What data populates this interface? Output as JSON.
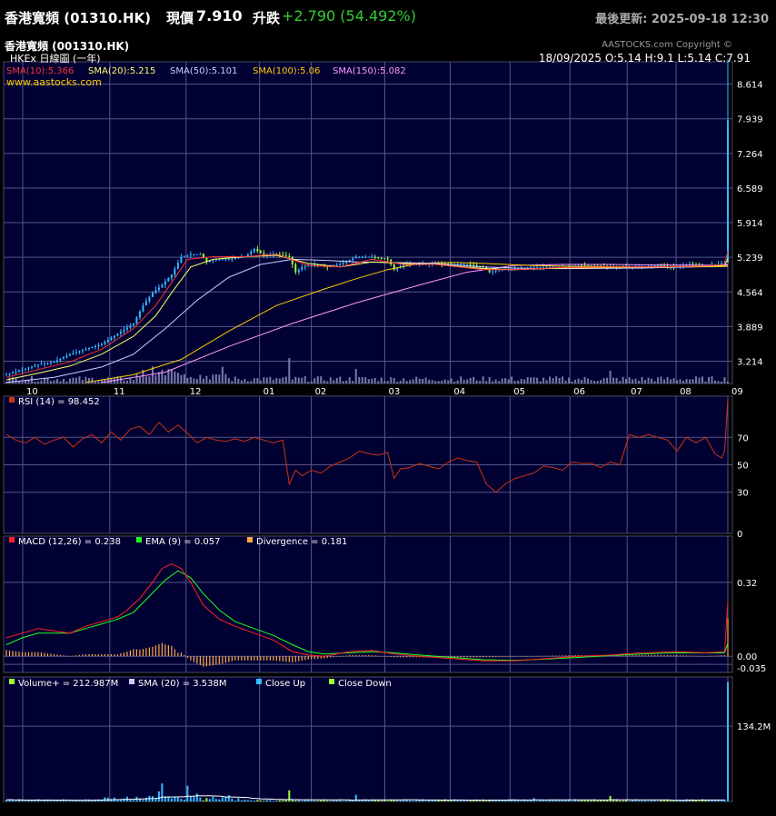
{
  "header": {
    "title": "香港寬頻 (01310.HK)",
    "price_label": "現價",
    "price": "7.910",
    "change_label": "升跌",
    "change": "+2.790 (54.492%)",
    "last_update": "最後更新: 2025-09-18 12:30"
  },
  "chart_info": {
    "name": "香港寬頻 (001310.HK)",
    "subtitle": "HKEx 日線圖 (一年)",
    "copyright": "AASTOCKS.com Copyright ©",
    "website": "www.aastocks.com",
    "ohlc": "18/09/2025   O:5.14  H:9.1  L:5.14  C:7.91"
  },
  "colors": {
    "bg": "#000033",
    "grid": "#55558a",
    "sma10": "#ff3333",
    "sma20": "#ffff66",
    "sma50": "#ccccff",
    "sma100": "#ffcc00",
    "sma150": "#ff99ff",
    "close_up": "#33bbff",
    "close_down": "#99ff33",
    "rsi": "#cc3311",
    "macd": "#ff2222",
    "ema": "#22ff22",
    "divergence": "#ffaa44"
  },
  "chart_data": [
    {
      "type": "line",
      "panel": "price",
      "legend": [
        {
          "key": "sma10",
          "label": "SMA(10):5.366"
        },
        {
          "key": "sma20",
          "label": "SMA(20):5.215"
        },
        {
          "key": "sma50",
          "label": "SMA(50):5.101"
        },
        {
          "key": "sma100",
          "label": "SMA(100):5.06"
        },
        {
          "key": "sma150",
          "label": "SMA(150):5.082"
        }
      ],
      "x_ticks": [
        "10",
        "11",
        "12",
        "01",
        "02",
        "03",
        "04",
        "05",
        "06",
        "07",
        "08",
        "09"
      ],
      "y_ticks": [
        3.214,
        3.889,
        4.564,
        5.239,
        5.914,
        6.589,
        7.264,
        7.939,
        8.614
      ],
      "ylim": [
        2.78,
        9.05
      ],
      "close_series": [
        [
          0,
          2.95
        ],
        [
          5,
          3.05
        ],
        [
          10,
          3.15
        ],
        [
          15,
          3.2
        ],
        [
          20,
          3.35
        ],
        [
          25,
          3.45
        ],
        [
          30,
          3.55
        ],
        [
          35,
          3.75
        ],
        [
          40,
          3.95
        ],
        [
          43,
          4.3
        ],
        [
          46,
          4.55
        ],
        [
          49,
          4.7
        ],
        [
          52,
          4.9
        ],
        [
          55,
          5.25
        ],
        [
          58,
          5.3
        ],
        [
          61,
          5.3
        ],
        [
          63,
          5.15
        ],
        [
          66,
          5.2
        ],
        [
          70,
          5.2
        ],
        [
          75,
          5.25
        ],
        [
          78,
          5.4
        ],
        [
          81,
          5.28
        ],
        [
          85,
          5.3
        ],
        [
          89,
          5.25
        ],
        [
          91,
          4.95
        ],
        [
          93,
          5.05
        ],
        [
          97,
          5.1
        ],
        [
          101,
          5.05
        ],
        [
          105,
          5.1
        ],
        [
          110,
          5.25
        ],
        [
          115,
          5.25
        ],
        [
          120,
          5.2
        ],
        [
          122,
          5.0
        ],
        [
          125,
          5.1
        ],
        [
          130,
          5.1
        ],
        [
          135,
          5.12
        ],
        [
          140,
          5.1
        ],
        [
          145,
          5.1
        ],
        [
          150,
          5.05
        ],
        [
          152,
          4.95
        ],
        [
          155,
          5.0
        ],
        [
          160,
          5.02
        ],
        [
          165,
          5.05
        ],
        [
          170,
          5.05
        ],
        [
          175,
          5.05
        ],
        [
          180,
          5.08
        ],
        [
          185,
          5.07
        ],
        [
          190,
          5.06
        ],
        [
          195,
          5.05
        ],
        [
          200,
          5.06
        ],
        [
          205,
          5.08
        ],
        [
          210,
          5.06
        ],
        [
          215,
          5.1
        ],
        [
          220,
          5.08
        ],
        [
          224,
          5.1
        ],
        [
          226,
          5.14
        ],
        [
          227,
          7.91
        ]
      ],
      "sma_series": {
        "sma10": [
          [
            0,
            2.9
          ],
          [
            10,
            3.05
          ],
          [
            20,
            3.2
          ],
          [
            30,
            3.45
          ],
          [
            40,
            3.85
          ],
          [
            47,
            4.3
          ],
          [
            52,
            4.75
          ],
          [
            57,
            5.2
          ],
          [
            65,
            5.25
          ],
          [
            75,
            5.25
          ],
          [
            85,
            5.3
          ],
          [
            95,
            5.08
          ],
          [
            105,
            5.05
          ],
          [
            115,
            5.2
          ],
          [
            125,
            5.1
          ],
          [
            135,
            5.1
          ],
          [
            150,
            5.0
          ],
          [
            160,
            5.0
          ],
          [
            175,
            5.04
          ],
          [
            190,
            5.05
          ],
          [
            205,
            5.05
          ],
          [
            220,
            5.07
          ],
          [
            226,
            5.1
          ],
          [
            227,
            5.366
          ]
        ],
        "sma20": [
          [
            0,
            2.85
          ],
          [
            10,
            2.98
          ],
          [
            20,
            3.12
          ],
          [
            30,
            3.35
          ],
          [
            40,
            3.7
          ],
          [
            47,
            4.1
          ],
          [
            52,
            4.55
          ],
          [
            58,
            5.05
          ],
          [
            65,
            5.2
          ],
          [
            75,
            5.25
          ],
          [
            85,
            5.28
          ],
          [
            95,
            5.12
          ],
          [
            105,
            5.05
          ],
          [
            115,
            5.15
          ],
          [
            125,
            5.12
          ],
          [
            135,
            5.1
          ],
          [
            150,
            5.02
          ],
          [
            160,
            5.0
          ],
          [
            175,
            5.03
          ],
          [
            190,
            5.04
          ],
          [
            205,
            5.05
          ],
          [
            220,
            5.06
          ],
          [
            226,
            5.08
          ],
          [
            227,
            5.215
          ]
        ],
        "sma50": [
          [
            0,
            2.8
          ],
          [
            15,
            2.9
          ],
          [
            30,
            3.1
          ],
          [
            40,
            3.35
          ],
          [
            50,
            3.85
          ],
          [
            60,
            4.4
          ],
          [
            70,
            4.85
          ],
          [
            80,
            5.1
          ],
          [
            90,
            5.2
          ],
          [
            100,
            5.18
          ],
          [
            110,
            5.15
          ],
          [
            120,
            5.14
          ],
          [
            135,
            5.12
          ],
          [
            150,
            5.05
          ],
          [
            165,
            5.02
          ],
          [
            180,
            5.02
          ],
          [
            200,
            5.03
          ],
          [
            215,
            5.05
          ],
          [
            227,
            5.101
          ]
        ],
        "sma100": [
          [
            25,
            2.8
          ],
          [
            40,
            2.95
          ],
          [
            55,
            3.25
          ],
          [
            70,
            3.8
          ],
          [
            85,
            4.3
          ],
          [
            100,
            4.62
          ],
          [
            110,
            4.82
          ],
          [
            120,
            5.0
          ],
          [
            130,
            5.12
          ],
          [
            140,
            5.14
          ],
          [
            150,
            5.12
          ],
          [
            165,
            5.08
          ],
          [
            180,
            5.06
          ],
          [
            200,
            5.05
          ],
          [
            215,
            5.05
          ],
          [
            227,
            5.06
          ]
        ],
        "sma150": [
          [
            30,
            2.8
          ],
          [
            50,
            3.0
          ],
          [
            70,
            3.5
          ],
          [
            90,
            3.95
          ],
          [
            110,
            4.35
          ],
          [
            130,
            4.7
          ],
          [
            145,
            4.95
          ],
          [
            160,
            5.08
          ],
          [
            175,
            5.1
          ],
          [
            190,
            5.1
          ],
          [
            205,
            5.09
          ],
          [
            227,
            5.082
          ]
        ]
      }
    },
    {
      "type": "line",
      "panel": "rsi",
      "legend": [
        {
          "key": "rsi",
          "label": "RSI (14)  = 98.452"
        }
      ],
      "y_ticks": [
        0,
        30,
        50,
        70
      ],
      "ylim": [
        0,
        100
      ],
      "values": [
        [
          0,
          72
        ],
        [
          3,
          68
        ],
        [
          6,
          66
        ],
        [
          9,
          70
        ],
        [
          12,
          65
        ],
        [
          15,
          68
        ],
        [
          18,
          70
        ],
        [
          21,
          63
        ],
        [
          24,
          69
        ],
        [
          27,
          72
        ],
        [
          30,
          66
        ],
        [
          33,
          74
        ],
        [
          36,
          68
        ],
        [
          39,
          76
        ],
        [
          42,
          78
        ],
        [
          45,
          72
        ],
        [
          48,
          81
        ],
        [
          51,
          74
        ],
        [
          54,
          79
        ],
        [
          57,
          73
        ],
        [
          60,
          66
        ],
        [
          63,
          70
        ],
        [
          66,
          68
        ],
        [
          69,
          67
        ],
        [
          72,
          69
        ],
        [
          75,
          67
        ],
        [
          78,
          70
        ],
        [
          81,
          68
        ],
        [
          84,
          66
        ],
        [
          87,
          68
        ],
        [
          89,
          36
        ],
        [
          91,
          46
        ],
        [
          93,
          42
        ],
        [
          96,
          46
        ],
        [
          99,
          44
        ],
        [
          102,
          49
        ],
        [
          105,
          52
        ],
        [
          108,
          55
        ],
        [
          111,
          60
        ],
        [
          114,
          58
        ],
        [
          117,
          57
        ],
        [
          120,
          59
        ],
        [
          122,
          40
        ],
        [
          124,
          47
        ],
        [
          127,
          48
        ],
        [
          130,
          51
        ],
        [
          133,
          49
        ],
        [
          136,
          47
        ],
        [
          139,
          52
        ],
        [
          142,
          55
        ],
        [
          145,
          53
        ],
        [
          148,
          52
        ],
        [
          151,
          36
        ],
        [
          154,
          30
        ],
        [
          157,
          36
        ],
        [
          160,
          40
        ],
        [
          163,
          42
        ],
        [
          166,
          44
        ],
        [
          169,
          49
        ],
        [
          172,
          48
        ],
        [
          175,
          46
        ],
        [
          178,
          52
        ],
        [
          181,
          51
        ],
        [
          184,
          51
        ],
        [
          187,
          48
        ],
        [
          190,
          52
        ],
        [
          193,
          50
        ],
        [
          196,
          72
        ],
        [
          199,
          70
        ],
        [
          202,
          72
        ],
        [
          205,
          70
        ],
        [
          208,
          68
        ],
        [
          211,
          60
        ],
        [
          214,
          70
        ],
        [
          217,
          66
        ],
        [
          220,
          70
        ],
        [
          223,
          58
        ],
        [
          225,
          55
        ],
        [
          226,
          60
        ],
        [
          227,
          98.452
        ]
      ]
    },
    {
      "type": "line",
      "panel": "macd",
      "legend": [
        {
          "key": "macd",
          "label": "MACD (12,26) = 0.238"
        },
        {
          "key": "ema",
          "label": "EMA (9) = 0.057"
        },
        {
          "key": "divergence",
          "label": "Divergence = 0.181"
        }
      ],
      "y_ticks": [
        -0.035,
        0.0,
        0.32
      ],
      "ylim": [
        -0.07,
        0.52
      ],
      "macd_values": [
        [
          0,
          0.08
        ],
        [
          5,
          0.1
        ],
        [
          10,
          0.12
        ],
        [
          15,
          0.11
        ],
        [
          20,
          0.1
        ],
        [
          25,
          0.13
        ],
        [
          30,
          0.15
        ],
        [
          35,
          0.17
        ],
        [
          38,
          0.2
        ],
        [
          42,
          0.25
        ],
        [
          46,
          0.32
        ],
        [
          49,
          0.38
        ],
        [
          52,
          0.4
        ],
        [
          55,
          0.38
        ],
        [
          58,
          0.32
        ],
        [
          62,
          0.22
        ],
        [
          67,
          0.16
        ],
        [
          72,
          0.13
        ],
        [
          78,
          0.1
        ],
        [
          84,
          0.07
        ],
        [
          90,
          0.02
        ],
        [
          95,
          0.005
        ],
        [
          100,
          0.0
        ],
        [
          108,
          0.02
        ],
        [
          115,
          0.025
        ],
        [
          122,
          0.01
        ],
        [
          130,
          0.0
        ],
        [
          140,
          -0.01
        ],
        [
          150,
          -0.02
        ],
        [
          160,
          -0.02
        ],
        [
          170,
          -0.01
        ],
        [
          180,
          0.0
        ],
        [
          190,
          0.005
        ],
        [
          200,
          0.015
        ],
        [
          210,
          0.02
        ],
        [
          220,
          0.015
        ],
        [
          226,
          0.02
        ],
        [
          227,
          0.238
        ]
      ],
      "ema_values": [
        [
          0,
          0.05
        ],
        [
          5,
          0.08
        ],
        [
          10,
          0.1
        ],
        [
          15,
          0.1
        ],
        [
          20,
          0.1
        ],
        [
          25,
          0.12
        ],
        [
          30,
          0.14
        ],
        [
          35,
          0.16
        ],
        [
          40,
          0.19
        ],
        [
          45,
          0.26
        ],
        [
          50,
          0.33
        ],
        [
          54,
          0.37
        ],
        [
          58,
          0.34
        ],
        [
          62,
          0.27
        ],
        [
          67,
          0.2
        ],
        [
          72,
          0.15
        ],
        [
          78,
          0.12
        ],
        [
          84,
          0.09
        ],
        [
          90,
          0.05
        ],
        [
          95,
          0.02
        ],
        [
          100,
          0.01
        ],
        [
          108,
          0.015
        ],
        [
          115,
          0.02
        ],
        [
          122,
          0.015
        ],
        [
          130,
          0.005
        ],
        [
          140,
          -0.005
        ],
        [
          150,
          -0.015
        ],
        [
          160,
          -0.018
        ],
        [
          170,
          -0.012
        ],
        [
          180,
          -0.005
        ],
        [
          190,
          0.003
        ],
        [
          200,
          0.01
        ],
        [
          210,
          0.015
        ],
        [
          220,
          0.014
        ],
        [
          226,
          0.015
        ],
        [
          227,
          0.057
        ]
      ]
    },
    {
      "type": "bar",
      "panel": "volume",
      "legend": [
        {
          "key": "close_down",
          "label": "Volume+  = 212.987M"
        },
        {
          "key": "sma50",
          "label": "SMA (20)  = 3.538M"
        },
        {
          "key": "close_up",
          "label": "Close Up"
        },
        {
          "key": "close_down",
          "label": "Close Down"
        }
      ],
      "y_ticks": [
        134.2
      ],
      "y_tick_labels": [
        "134.2M"
      ],
      "ylim": [
        0,
        222
      ],
      "last_volume": 212.987
    }
  ]
}
